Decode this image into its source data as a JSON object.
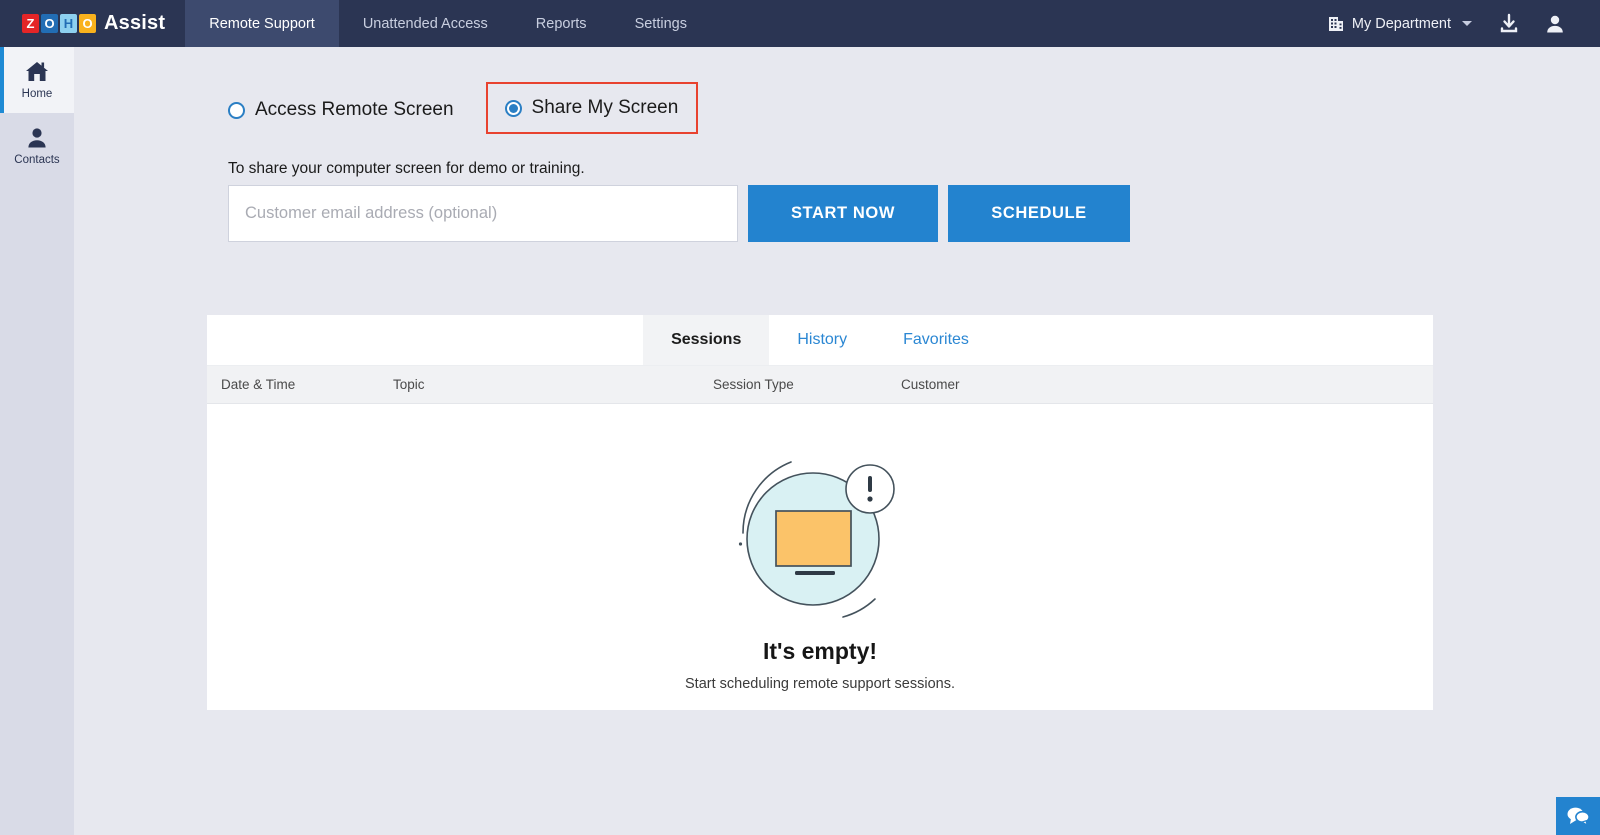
{
  "topbar": {
    "logo_letters": [
      "Z",
      "O",
      "H",
      "O"
    ],
    "brand_name": "Assist",
    "nav": [
      {
        "label": "Remote Support",
        "active": true
      },
      {
        "label": "Unattended Access",
        "active": false
      },
      {
        "label": "Reports",
        "active": false
      },
      {
        "label": "Settings",
        "active": false
      }
    ],
    "department": "My Department",
    "building_icon": "building-icon",
    "caret_icon": "chevron-down-icon",
    "download_icon": "download-icon",
    "profile_icon": "user-avatar-icon"
  },
  "sidebar": {
    "items": [
      {
        "label": "Home",
        "icon": "home-icon",
        "active": true
      },
      {
        "label": "Contacts",
        "icon": "contacts-icon",
        "active": false
      }
    ]
  },
  "main": {
    "modes": [
      {
        "label": "Access Remote Screen",
        "selected": false,
        "highlighted": false
      },
      {
        "label": "Share My Screen",
        "selected": true,
        "highlighted": true
      }
    ],
    "description": "To share your computer screen for demo or training.",
    "email_placeholder": "Customer email address (optional)",
    "email_value": "",
    "start_now_label": "START NOW",
    "schedule_label": "SCHEDULE"
  },
  "card": {
    "tabs": [
      {
        "label": "Sessions",
        "active": true
      },
      {
        "label": "History",
        "active": false
      },
      {
        "label": "Favorites",
        "active": false
      }
    ],
    "columns": [
      "Date & Time",
      "Topic",
      "Session Type",
      "Customer"
    ],
    "rows": [],
    "empty_state": {
      "illustration": "empty-monitor-alert-illustration",
      "title": "It's empty!",
      "subtitle": "Start scheduling remote support sessions."
    }
  },
  "chat": {
    "icon": "chat-bubbles-icon"
  },
  "colors": {
    "topbar_bg": "#2b3553",
    "topbar_active": "#3d4a6e",
    "page_bg": "#e7e8ef",
    "sidebar_bg": "#d9dbe7",
    "accent_blue": "#2383cf",
    "link_blue": "#2b87d3",
    "highlight_red": "#e8422f",
    "illustration_circle": "#d9f1f3",
    "illustration_screen": "#fbc369"
  }
}
